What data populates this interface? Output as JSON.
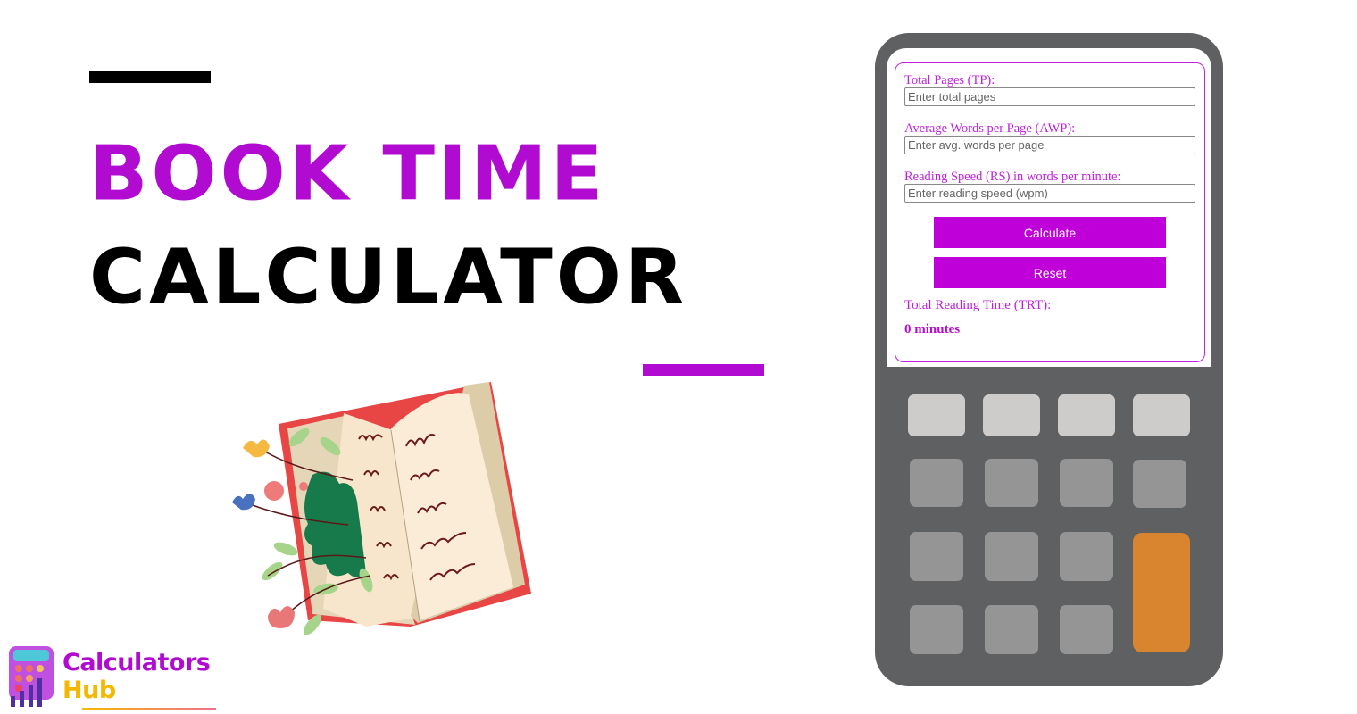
{
  "banner": {
    "title_line_1": "BOOK TIME",
    "title_line_2": "CALCULATOR",
    "accent_color": "#b10ad0"
  },
  "logo": {
    "line_1": "Calculators",
    "line_2": "Hub"
  },
  "calculator": {
    "fields": [
      {
        "label": "Total Pages (TP):",
        "placeholder": "Enter total pages",
        "value": ""
      },
      {
        "label": "Average Words per Page (AWP):",
        "placeholder": "Enter avg. words per page",
        "value": ""
      },
      {
        "label": "Reading Speed (RS) in words per minute:",
        "placeholder": "Enter reading speed (wpm)",
        "value": ""
      }
    ],
    "calculate_label": "Calculate",
    "reset_label": "Reset",
    "result_label": "Total Reading Time (TRT):",
    "result_value": "0 minutes"
  },
  "keypad": {
    "key_colors": {
      "light": "#cdccca",
      "grey": "#959595",
      "accent": "#d98530"
    }
  }
}
